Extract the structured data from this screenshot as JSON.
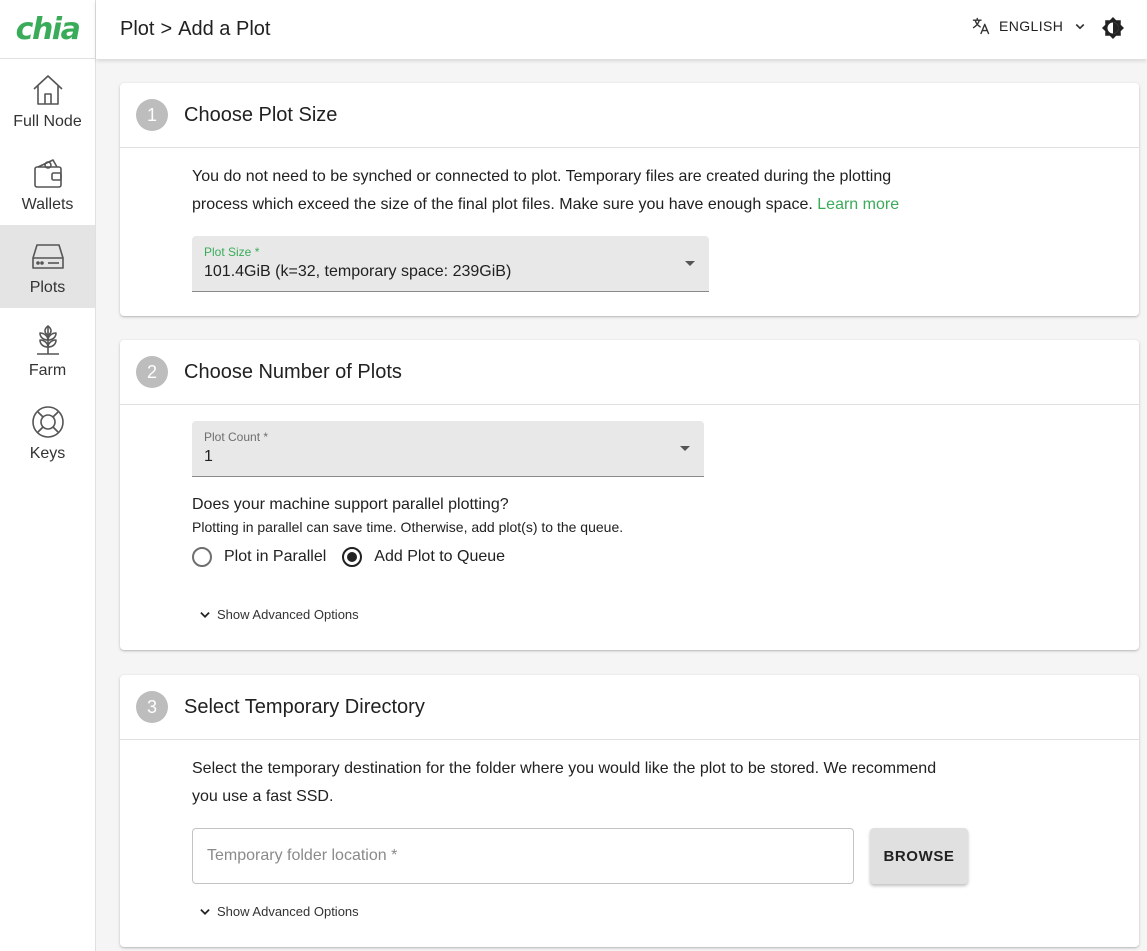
{
  "app": {
    "logo_text": "chia",
    "brand_color": "#3aac59"
  },
  "sidebar": {
    "items": [
      {
        "label": "Full Node",
        "icon": "home-icon"
      },
      {
        "label": "Wallets",
        "icon": "wallet-icon"
      },
      {
        "label": "Plots",
        "icon": "hard-drive-icon",
        "active": true
      },
      {
        "label": "Farm",
        "icon": "sprout-icon"
      },
      {
        "label": "Keys",
        "icon": "lifebuoy-icon"
      }
    ]
  },
  "header": {
    "breadcrumb": [
      "Plot",
      "Add a Plot"
    ],
    "separator": ">",
    "language": "ENGLISH",
    "language_icon": "translate-icon",
    "theme_icon": "brightness-icon"
  },
  "step1": {
    "number": "1",
    "title": "Choose Plot Size",
    "description_line1": "You do not need to be synched or connected to plot. Temporary files are created during the plotting",
    "description_line2": "process which exceed the size of the final plot files. Make sure you have enough space.",
    "learn_more": "Learn more",
    "plot_size_label": "Plot Size *",
    "plot_size_value": "101.4GiB (k=32, temporary space: 239GiB)"
  },
  "step2": {
    "number": "2",
    "title": "Choose Number of Plots",
    "plot_count_label": "Plot Count *",
    "plot_count_value": "1",
    "question": "Does your machine support parallel plotting?",
    "question_sub": "Plotting in parallel can save time. Otherwise, add plot(s) to the queue.",
    "options": [
      {
        "label": "Plot in Parallel",
        "selected": false
      },
      {
        "label": "Add Plot to Queue",
        "selected": true
      }
    ],
    "advanced": "Show Advanced Options"
  },
  "step3": {
    "number": "3",
    "title": "Select Temporary Directory",
    "description_line1": "Select the temporary destination for the folder where you would like the plot to be stored. We recommend",
    "description_line2": "you use a fast SSD.",
    "folder_placeholder": "Temporary folder location *",
    "browse_label": "BROWSE",
    "advanced": "Show Advanced Options"
  }
}
